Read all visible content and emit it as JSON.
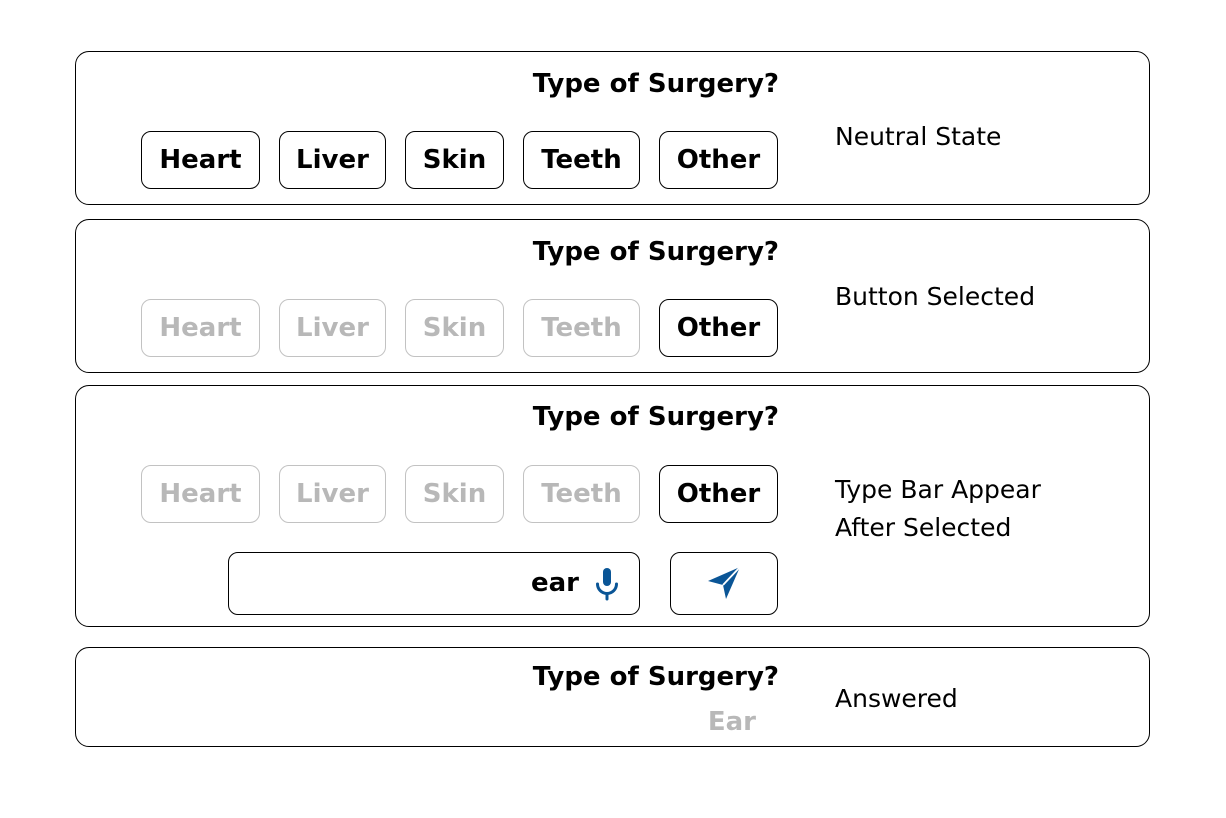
{
  "question": "Type of Surgery?",
  "options": [
    "Heart",
    "Liver",
    "Skin",
    "Teeth",
    "Other"
  ],
  "states": {
    "neutral": "Neutral State",
    "selected": "Button Selected",
    "type_bar_line1": "Type Bar Appear",
    "type_bar_line2": "After Selected",
    "answered": "Answered"
  },
  "input": {
    "value": "ear",
    "mic_icon": "mic-icon",
    "send_icon": "send-icon"
  },
  "answer_value": "Ear",
  "colors": {
    "accent": "#0a5596",
    "dim": "#b8b8b8",
    "border": "#000000"
  }
}
